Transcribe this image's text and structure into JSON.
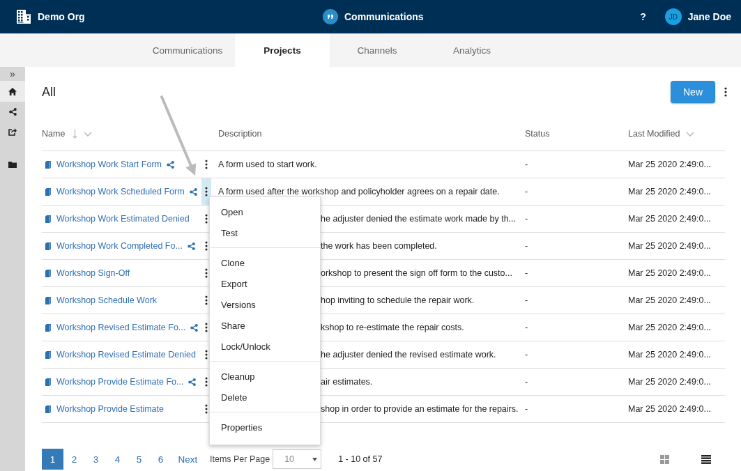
{
  "header": {
    "org": "Demo Org",
    "app": "Communications",
    "help": "?",
    "user_initials": "JD",
    "user_name": "Jane Doe"
  },
  "tabs": [
    {
      "label": "Communications",
      "selected": false
    },
    {
      "label": "Projects",
      "selected": true
    },
    {
      "label": "Channels",
      "selected": false
    },
    {
      "label": "Analytics",
      "selected": false
    }
  ],
  "sidebar": {
    "expand": "»",
    "items": [
      {
        "kind": "home",
        "selected": true
      },
      {
        "kind": "share",
        "selected": false
      },
      {
        "kind": "export",
        "selected": false
      },
      {
        "kind": "folder",
        "selected": false
      }
    ]
  },
  "page": {
    "title": "All",
    "new_button": "New"
  },
  "table": {
    "columns": [
      {
        "label": "Name",
        "sortable": true,
        "sorted": true
      },
      {
        "label": "Description",
        "sortable": false,
        "sorted": false
      },
      {
        "label": "Status",
        "sortable": false,
        "sorted": false
      },
      {
        "label": "Last Modified",
        "sortable": true,
        "sorted": false
      }
    ],
    "rows": [
      {
        "name": "Workshop Work Start Form",
        "shared": true,
        "menu_open": false,
        "description": "A form used to start work.",
        "status": "-",
        "modified": "Mar 25 2020 2:49:0..."
      },
      {
        "name": "Workshop Work Scheduled Form",
        "shared": true,
        "menu_open": true,
        "description": "A form used after the workshop and policyholder agrees on a repair date.",
        "status": "-",
        "modified": "Mar 25 2020 2:49:0..."
      },
      {
        "name": "Workshop Work Estimated Denied",
        "shared": false,
        "menu_open": false,
        "description": "he adjuster denied the estimate work made by th...",
        "status": "-",
        "modified": "Mar 25 2020 2:49:0..."
      },
      {
        "name": "Workshop Work Completed Fo...",
        "shared": true,
        "menu_open": false,
        "description": "the work has been completed.",
        "status": "-",
        "modified": "Mar 25 2020 2:49:0..."
      },
      {
        "name": "Workshop Sign-Off",
        "shared": false,
        "menu_open": false,
        "description": "orkshop to present the sign off form to the custo...",
        "status": "-",
        "modified": "Mar 25 2020 2:49:0..."
      },
      {
        "name": "Workshop Schedule Work",
        "shared": false,
        "menu_open": false,
        "description": "hop inviting to schedule the repair work.",
        "status": "-",
        "modified": "Mar 25 2020 2:49:0..."
      },
      {
        "name": "Workshop Revised Estimate Fo...",
        "shared": true,
        "menu_open": false,
        "description": "kshop to re-estimate the repair costs.",
        "status": "-",
        "modified": "Mar 25 2020 2:49:0..."
      },
      {
        "name": "Workshop Revised Estimate Denied",
        "shared": false,
        "menu_open": false,
        "description": "he adjuster denied the revised estimate work.",
        "status": "-",
        "modified": "Mar 25 2020 2:49:0..."
      },
      {
        "name": "Workshop Provide Estimate Fo...",
        "shared": true,
        "menu_open": false,
        "description": "air estimates.",
        "status": "-",
        "modified": "Mar 25 2020 2:49:0..."
      },
      {
        "name": "Workshop Provide Estimate",
        "shared": false,
        "menu_open": false,
        "description": "shop in order to provide an estimate for the repairs.",
        "status": "-",
        "modified": "Mar 25 2020 2:49:0..."
      }
    ]
  },
  "context_menu": {
    "groups": [
      [
        "Open",
        "Test"
      ],
      [
        "Clone",
        "Export",
        "Versions",
        "Share",
        "Lock/Unlock"
      ],
      [
        "Cleanup",
        "Delete"
      ],
      [
        "Properties"
      ]
    ]
  },
  "pagination": {
    "pages": [
      {
        "label": "1",
        "selected": true
      },
      {
        "label": "2",
        "selected": false
      },
      {
        "label": "3",
        "selected": false
      },
      {
        "label": "4",
        "selected": false
      },
      {
        "label": "5",
        "selected": false
      },
      {
        "label": "6",
        "selected": false
      }
    ],
    "next": "Next",
    "items_per_page_label": "Items Per Page",
    "items_per_page": "10",
    "range": "1 - 10 of 57"
  },
  "view_modes": [
    {
      "kind": "grid",
      "selected": false
    },
    {
      "kind": "list",
      "selected": true
    }
  ]
}
